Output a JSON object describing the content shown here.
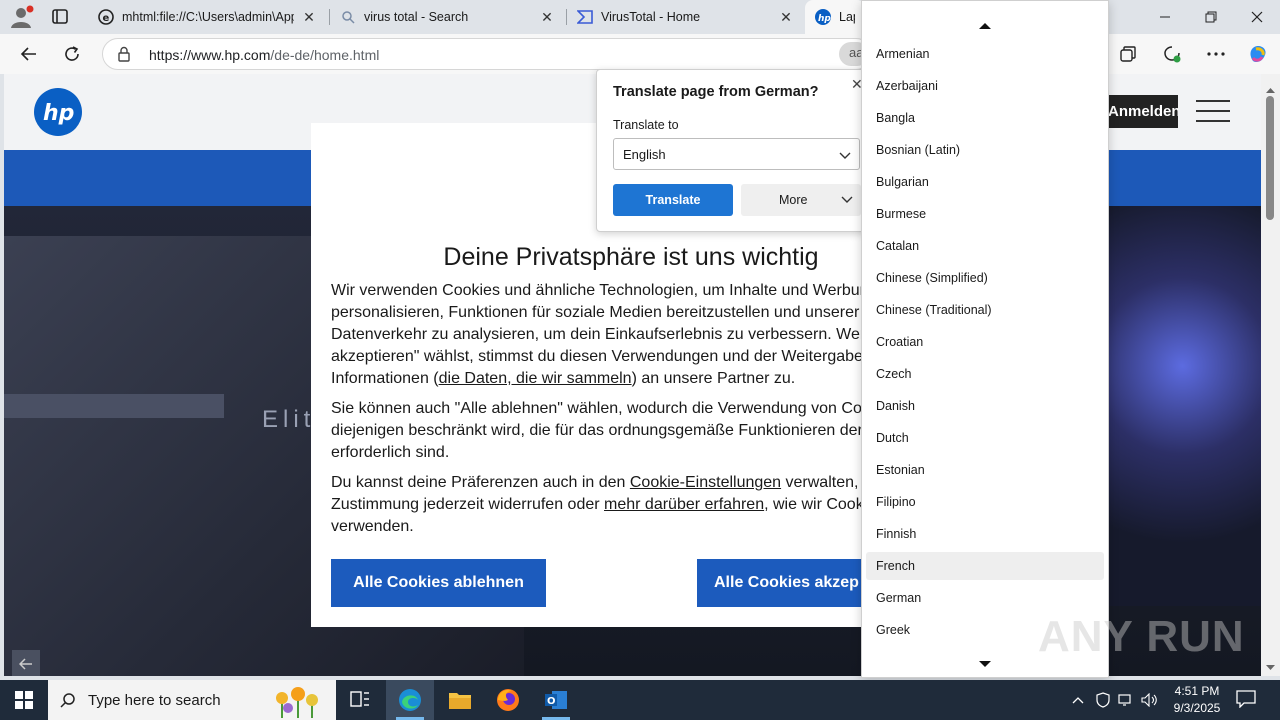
{
  "browser": {
    "tabs": [
      {
        "title": "mhtml:file://C:\\Users\\admin\\AppD",
        "icon": "edge-file-icon"
      },
      {
        "title": "virus total - Search",
        "icon": "search-icon"
      },
      {
        "title": "VirusTotal - Home",
        "icon": "virustotal-icon"
      },
      {
        "title": "Lapt",
        "icon": "hp-icon"
      }
    ],
    "url_host": "https://www.hp.com",
    "url_path": "/de-de/home.html",
    "translate_pill": "aa"
  },
  "hp_page": {
    "signin_label": "Anmelden",
    "laptop_text": "Elit"
  },
  "cookie": {
    "title": "Deine Privatsphäre ist uns wichtig",
    "p1_l1": "Wir verwenden Cookies und ähnliche Technologien, um Inhalte und Werbun",
    "p1_l2": "personalisieren, Funktionen für soziale Medien bereitzustellen und unserer",
    "p1_l3": "Datenverkehr zu analysieren, um dein Einkaufserlebnis zu verbessern. Wen",
    "p1_l4": "akzeptieren\" wählst, stimmst du diesen Verwendungen und der Weitergabe",
    "p1_l5a": "Informationen (",
    "p1_link": "die Daten, die wir sammeln",
    "p1_l5b": ") an unsere Partner zu.",
    "p2_l1": "Sie können auch \"Alle ablehnen\" wählen, wodurch die Verwendung von Coo",
    "p2_l2": "diejenigen beschränkt wird, die für das ordnungsgemäße Funktionieren der",
    "p2_l3": "erforderlich sind.",
    "p3_l1a": "Du kannst deine Präferenzen auch in den ",
    "p3_link1": "Cookie-Einstellungen",
    "p3_l1b": " verwalten, d",
    "p3_l2a": "Zustimmung jederzeit widerrufen oder ",
    "p3_link2": "mehr darüber erfahren",
    "p3_l2b": ", wie wir Cook",
    "p3_l3": "verwenden.",
    "reject_label": "Alle Cookies ablehnen",
    "accept_label": "Alle Cookies akzep"
  },
  "translate": {
    "title": "Translate page from German?",
    "to_label": "Translate to",
    "selected": "English",
    "translate_button": "Translate",
    "more_button": "More"
  },
  "languages": {
    "items": [
      "Armenian",
      "Azerbaijani",
      "Bangla",
      "Bosnian (Latin)",
      "Bulgarian",
      "Burmese",
      "Catalan",
      "Chinese (Simplified)",
      "Chinese (Traditional)",
      "Croatian",
      "Czech",
      "Danish",
      "Dutch",
      "Estonian",
      "Filipino",
      "Finnish",
      "French",
      "German",
      "Greek"
    ],
    "hovered": "French"
  },
  "watermark": "ANY RUN",
  "taskbar": {
    "search_placeholder": "Type here to search",
    "time": "4:51 PM",
    "date": "9/3/2025"
  },
  "colors": {
    "accent_blue": "#1c5bbd",
    "translate_blue": "#1e75d3",
    "hp_band": "#1d59b8"
  }
}
